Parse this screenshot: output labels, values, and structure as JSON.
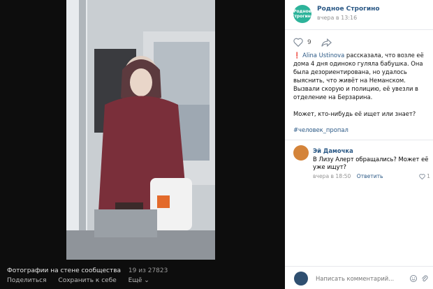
{
  "community": {
    "avatar_text": "Родное Строгино",
    "name": "Родное Строгино",
    "time": "вчера в 13:16"
  },
  "actions": {
    "likes": "9"
  },
  "post": {
    "mark": "❗",
    "author": "Alina Ustinova",
    "text": " рассказала, что возле её дома 4 дня одиноко гуляла бабушка. Она была дезориентирована, но удалось выяснить, что живёт на Неманском. Вызвали скорую и полицию, её увезли в отделение на Берзарина.",
    "question": "Может, кто-нибудь её ищет или знает?",
    "hashtag": "#человек_пропал"
  },
  "comment": {
    "author": "Эй Дамочка",
    "text": "В Лизу Алерт обращались? Может её уже ищут?",
    "time": "вчера в 18:50",
    "reply": "Ответить",
    "likes": "1"
  },
  "photo_footer": {
    "title": "Фотографии на стене сообщества",
    "counter": "19 из 27823",
    "share": "Поделиться",
    "save": "Сохранить к себе",
    "more": "Ещё ⌄"
  },
  "input": {
    "placeholder": "Написать комментарий..."
  },
  "colors": {
    "link": "#2a5885",
    "avatar_bg": "#2db39a"
  }
}
